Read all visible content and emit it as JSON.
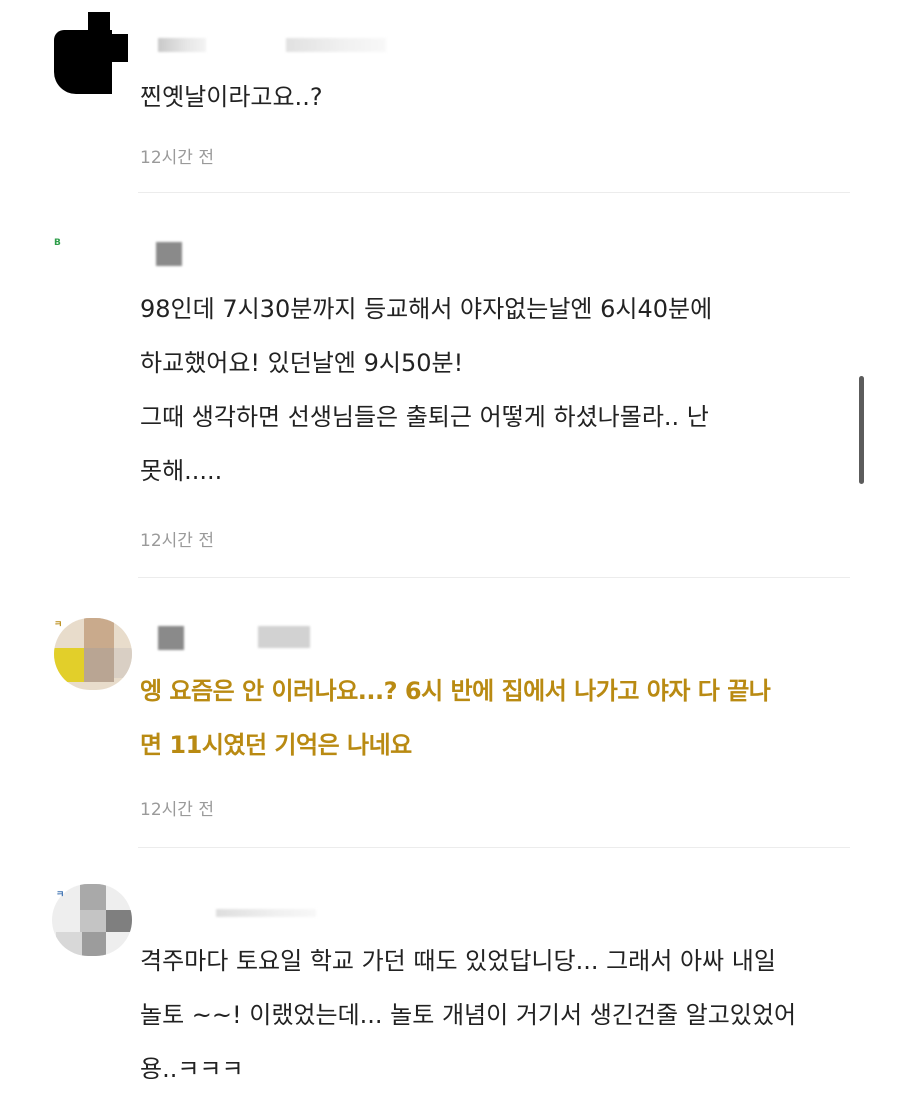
{
  "comments": [
    {
      "text_lines": [
        "찐옛날이라고요..?"
      ],
      "time": "12시간 전"
    },
    {
      "text_lines": [
        "98인데 7시30분까지 등교해서 야자없는날엔 6시40분에",
        "하교했어요! 있던날엔 9시50분!",
        "그때 생각하면 선생님들은 출퇴근 어떻게 하셨나몰라.. 난",
        "못해....."
      ],
      "time": "12시간 전"
    },
    {
      "text_lines": [
        "엥 요즘은 안 이러나요...? 6시 반에 집에서 나가고 야자 다 끝나",
        "면 11시였던 기억은 나네요"
      ],
      "time": "12시간 전",
      "highlight_color": "#b98a12"
    },
    {
      "text_lines": [
        "격주마다 토요일 학교 가던 때도 있었답니당... 그래서 아싸 내일",
        "놀토 ~~! 이랬었는데... 놀토 개념이 거기서 생긴건줄 알고있었어",
        "용..ㅋㅋㅋ"
      ]
    }
  ],
  "colors": {
    "text": "#222222",
    "time": "#9a9a9a",
    "highlight": "#b98a12",
    "divider": "#ececec",
    "scrollbar": "#5c5c5c"
  }
}
